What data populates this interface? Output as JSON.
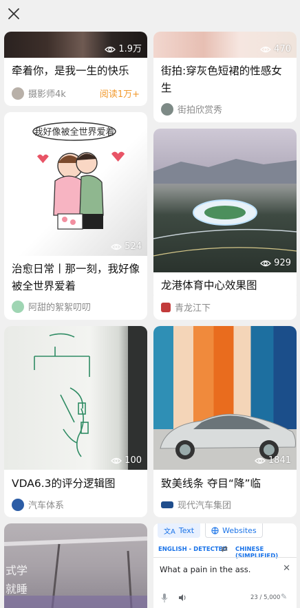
{
  "cards": [
    {
      "title": "牵着你，是我一生的快乐",
      "views": "1.9万",
      "author": "摄影师4k",
      "read": "阅读1万+"
    },
    {
      "title": "街拍:穿灰色短裙的性感女生",
      "views": "470",
      "author": "街拍欣赏秀"
    },
    {
      "title": "治愈日常丨那一刻，我好像被全世界爱着",
      "views": "524",
      "author": "阿甜的絮絮叨叨",
      "img_text": "我好像被全世界爱着"
    },
    {
      "title": "龙港体育中心效果图",
      "views": "929",
      "author": "青龙江下"
    },
    {
      "title": "VDA6.3的评分逻辑图",
      "views": "100",
      "author": "汽车体系"
    },
    {
      "title": "致美线条 夺目“降”临",
      "views": "1841",
      "author": "现代汽车集团"
    }
  ],
  "partial_card_text": [
    "式学",
    "就睡"
  ],
  "translate": {
    "tabs": [
      "Text",
      "Websites"
    ],
    "source_lang": "ENGLISH - DETECTED",
    "target_lang": "CHINESE (SIMPLIFIED)",
    "input_text": "What a pain in the ass.",
    "char_count": "23 / 5,000"
  },
  "colors": {
    "accent": "#1a73e8",
    "read_orange": "#f29a2e"
  }
}
